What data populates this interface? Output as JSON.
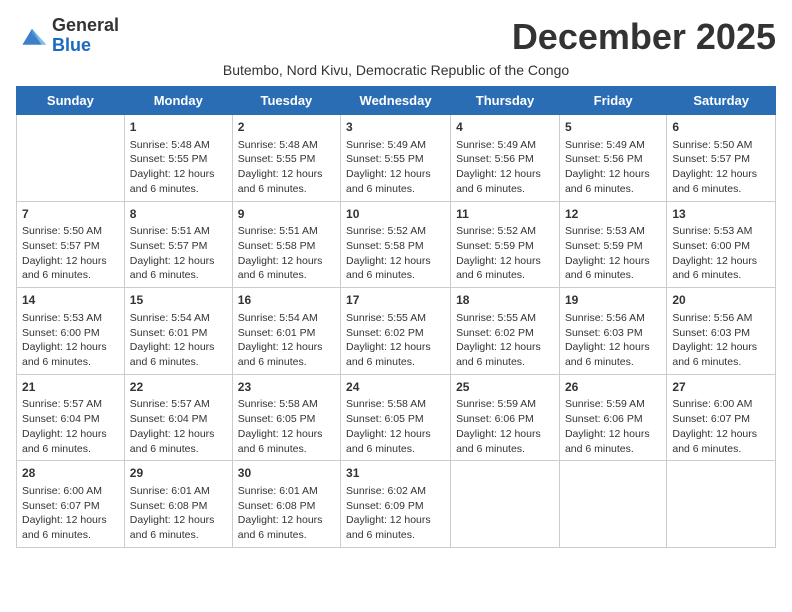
{
  "logo": {
    "general": "General",
    "blue": "Blue"
  },
  "title": "December 2025",
  "subtitle": "Butembo, Nord Kivu, Democratic Republic of the Congo",
  "days_of_week": [
    "Sunday",
    "Monday",
    "Tuesday",
    "Wednesday",
    "Thursday",
    "Friday",
    "Saturday"
  ],
  "weeks": [
    [
      {
        "day": "",
        "sunrise": "",
        "sunset": "",
        "daylight": ""
      },
      {
        "day": "1",
        "sunrise": "Sunrise: 5:48 AM",
        "sunset": "Sunset: 5:55 PM",
        "daylight": "Daylight: 12 hours and 6 minutes."
      },
      {
        "day": "2",
        "sunrise": "Sunrise: 5:48 AM",
        "sunset": "Sunset: 5:55 PM",
        "daylight": "Daylight: 12 hours and 6 minutes."
      },
      {
        "day": "3",
        "sunrise": "Sunrise: 5:49 AM",
        "sunset": "Sunset: 5:55 PM",
        "daylight": "Daylight: 12 hours and 6 minutes."
      },
      {
        "day": "4",
        "sunrise": "Sunrise: 5:49 AM",
        "sunset": "Sunset: 5:56 PM",
        "daylight": "Daylight: 12 hours and 6 minutes."
      },
      {
        "day": "5",
        "sunrise": "Sunrise: 5:49 AM",
        "sunset": "Sunset: 5:56 PM",
        "daylight": "Daylight: 12 hours and 6 minutes."
      },
      {
        "day": "6",
        "sunrise": "Sunrise: 5:50 AM",
        "sunset": "Sunset: 5:57 PM",
        "daylight": "Daylight: 12 hours and 6 minutes."
      }
    ],
    [
      {
        "day": "7",
        "sunrise": "Sunrise: 5:50 AM",
        "sunset": "Sunset: 5:57 PM",
        "daylight": "Daylight: 12 hours and 6 minutes."
      },
      {
        "day": "8",
        "sunrise": "Sunrise: 5:51 AM",
        "sunset": "Sunset: 5:57 PM",
        "daylight": "Daylight: 12 hours and 6 minutes."
      },
      {
        "day": "9",
        "sunrise": "Sunrise: 5:51 AM",
        "sunset": "Sunset: 5:58 PM",
        "daylight": "Daylight: 12 hours and 6 minutes."
      },
      {
        "day": "10",
        "sunrise": "Sunrise: 5:52 AM",
        "sunset": "Sunset: 5:58 PM",
        "daylight": "Daylight: 12 hours and 6 minutes."
      },
      {
        "day": "11",
        "sunrise": "Sunrise: 5:52 AM",
        "sunset": "Sunset: 5:59 PM",
        "daylight": "Daylight: 12 hours and 6 minutes."
      },
      {
        "day": "12",
        "sunrise": "Sunrise: 5:53 AM",
        "sunset": "Sunset: 5:59 PM",
        "daylight": "Daylight: 12 hours and 6 minutes."
      },
      {
        "day": "13",
        "sunrise": "Sunrise: 5:53 AM",
        "sunset": "Sunset: 6:00 PM",
        "daylight": "Daylight: 12 hours and 6 minutes."
      }
    ],
    [
      {
        "day": "14",
        "sunrise": "Sunrise: 5:53 AM",
        "sunset": "Sunset: 6:00 PM",
        "daylight": "Daylight: 12 hours and 6 minutes."
      },
      {
        "day": "15",
        "sunrise": "Sunrise: 5:54 AM",
        "sunset": "Sunset: 6:01 PM",
        "daylight": "Daylight: 12 hours and 6 minutes."
      },
      {
        "day": "16",
        "sunrise": "Sunrise: 5:54 AM",
        "sunset": "Sunset: 6:01 PM",
        "daylight": "Daylight: 12 hours and 6 minutes."
      },
      {
        "day": "17",
        "sunrise": "Sunrise: 5:55 AM",
        "sunset": "Sunset: 6:02 PM",
        "daylight": "Daylight: 12 hours and 6 minutes."
      },
      {
        "day": "18",
        "sunrise": "Sunrise: 5:55 AM",
        "sunset": "Sunset: 6:02 PM",
        "daylight": "Daylight: 12 hours and 6 minutes."
      },
      {
        "day": "19",
        "sunrise": "Sunrise: 5:56 AM",
        "sunset": "Sunset: 6:03 PM",
        "daylight": "Daylight: 12 hours and 6 minutes."
      },
      {
        "day": "20",
        "sunrise": "Sunrise: 5:56 AM",
        "sunset": "Sunset: 6:03 PM",
        "daylight": "Daylight: 12 hours and 6 minutes."
      }
    ],
    [
      {
        "day": "21",
        "sunrise": "Sunrise: 5:57 AM",
        "sunset": "Sunset: 6:04 PM",
        "daylight": "Daylight: 12 hours and 6 minutes."
      },
      {
        "day": "22",
        "sunrise": "Sunrise: 5:57 AM",
        "sunset": "Sunset: 6:04 PM",
        "daylight": "Daylight: 12 hours and 6 minutes."
      },
      {
        "day": "23",
        "sunrise": "Sunrise: 5:58 AM",
        "sunset": "Sunset: 6:05 PM",
        "daylight": "Daylight: 12 hours and 6 minutes."
      },
      {
        "day": "24",
        "sunrise": "Sunrise: 5:58 AM",
        "sunset": "Sunset: 6:05 PM",
        "daylight": "Daylight: 12 hours and 6 minutes."
      },
      {
        "day": "25",
        "sunrise": "Sunrise: 5:59 AM",
        "sunset": "Sunset: 6:06 PM",
        "daylight": "Daylight: 12 hours and 6 minutes."
      },
      {
        "day": "26",
        "sunrise": "Sunrise: 5:59 AM",
        "sunset": "Sunset: 6:06 PM",
        "daylight": "Daylight: 12 hours and 6 minutes."
      },
      {
        "day": "27",
        "sunrise": "Sunrise: 6:00 AM",
        "sunset": "Sunset: 6:07 PM",
        "daylight": "Daylight: 12 hours and 6 minutes."
      }
    ],
    [
      {
        "day": "28",
        "sunrise": "Sunrise: 6:00 AM",
        "sunset": "Sunset: 6:07 PM",
        "daylight": "Daylight: 12 hours and 6 minutes."
      },
      {
        "day": "29",
        "sunrise": "Sunrise: 6:01 AM",
        "sunset": "Sunset: 6:08 PM",
        "daylight": "Daylight: 12 hours and 6 minutes."
      },
      {
        "day": "30",
        "sunrise": "Sunrise: 6:01 AM",
        "sunset": "Sunset: 6:08 PM",
        "daylight": "Daylight: 12 hours and 6 minutes."
      },
      {
        "day": "31",
        "sunrise": "Sunrise: 6:02 AM",
        "sunset": "Sunset: 6:09 PM",
        "daylight": "Daylight: 12 hours and 6 minutes."
      },
      {
        "day": "",
        "sunrise": "",
        "sunset": "",
        "daylight": ""
      },
      {
        "day": "",
        "sunrise": "",
        "sunset": "",
        "daylight": ""
      },
      {
        "day": "",
        "sunrise": "",
        "sunset": "",
        "daylight": ""
      }
    ]
  ]
}
